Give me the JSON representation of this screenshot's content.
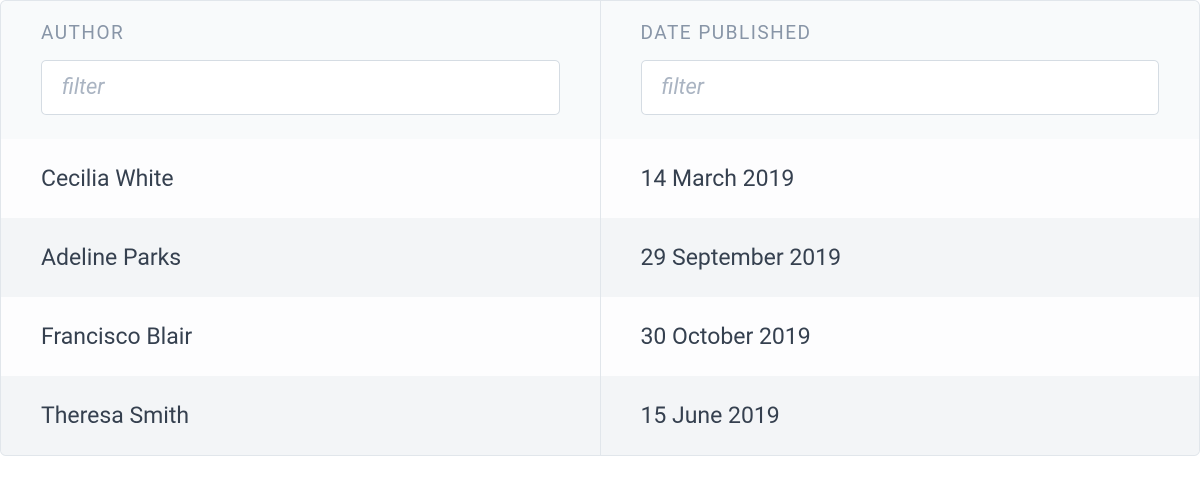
{
  "table": {
    "columns": [
      {
        "key": "author",
        "label": "AUTHOR",
        "filter_placeholder": "filter"
      },
      {
        "key": "date_published",
        "label": "DATE PUBLISHED",
        "filter_placeholder": "filter"
      }
    ],
    "rows": [
      {
        "author": "Cecilia White",
        "date_published": "14 March 2019"
      },
      {
        "author": "Adeline Parks",
        "date_published": "29 September 2019"
      },
      {
        "author": "Francisco Blair",
        "date_published": "30 October 2019"
      },
      {
        "author": "Theresa Smith",
        "date_published": "15 June 2019"
      }
    ]
  }
}
